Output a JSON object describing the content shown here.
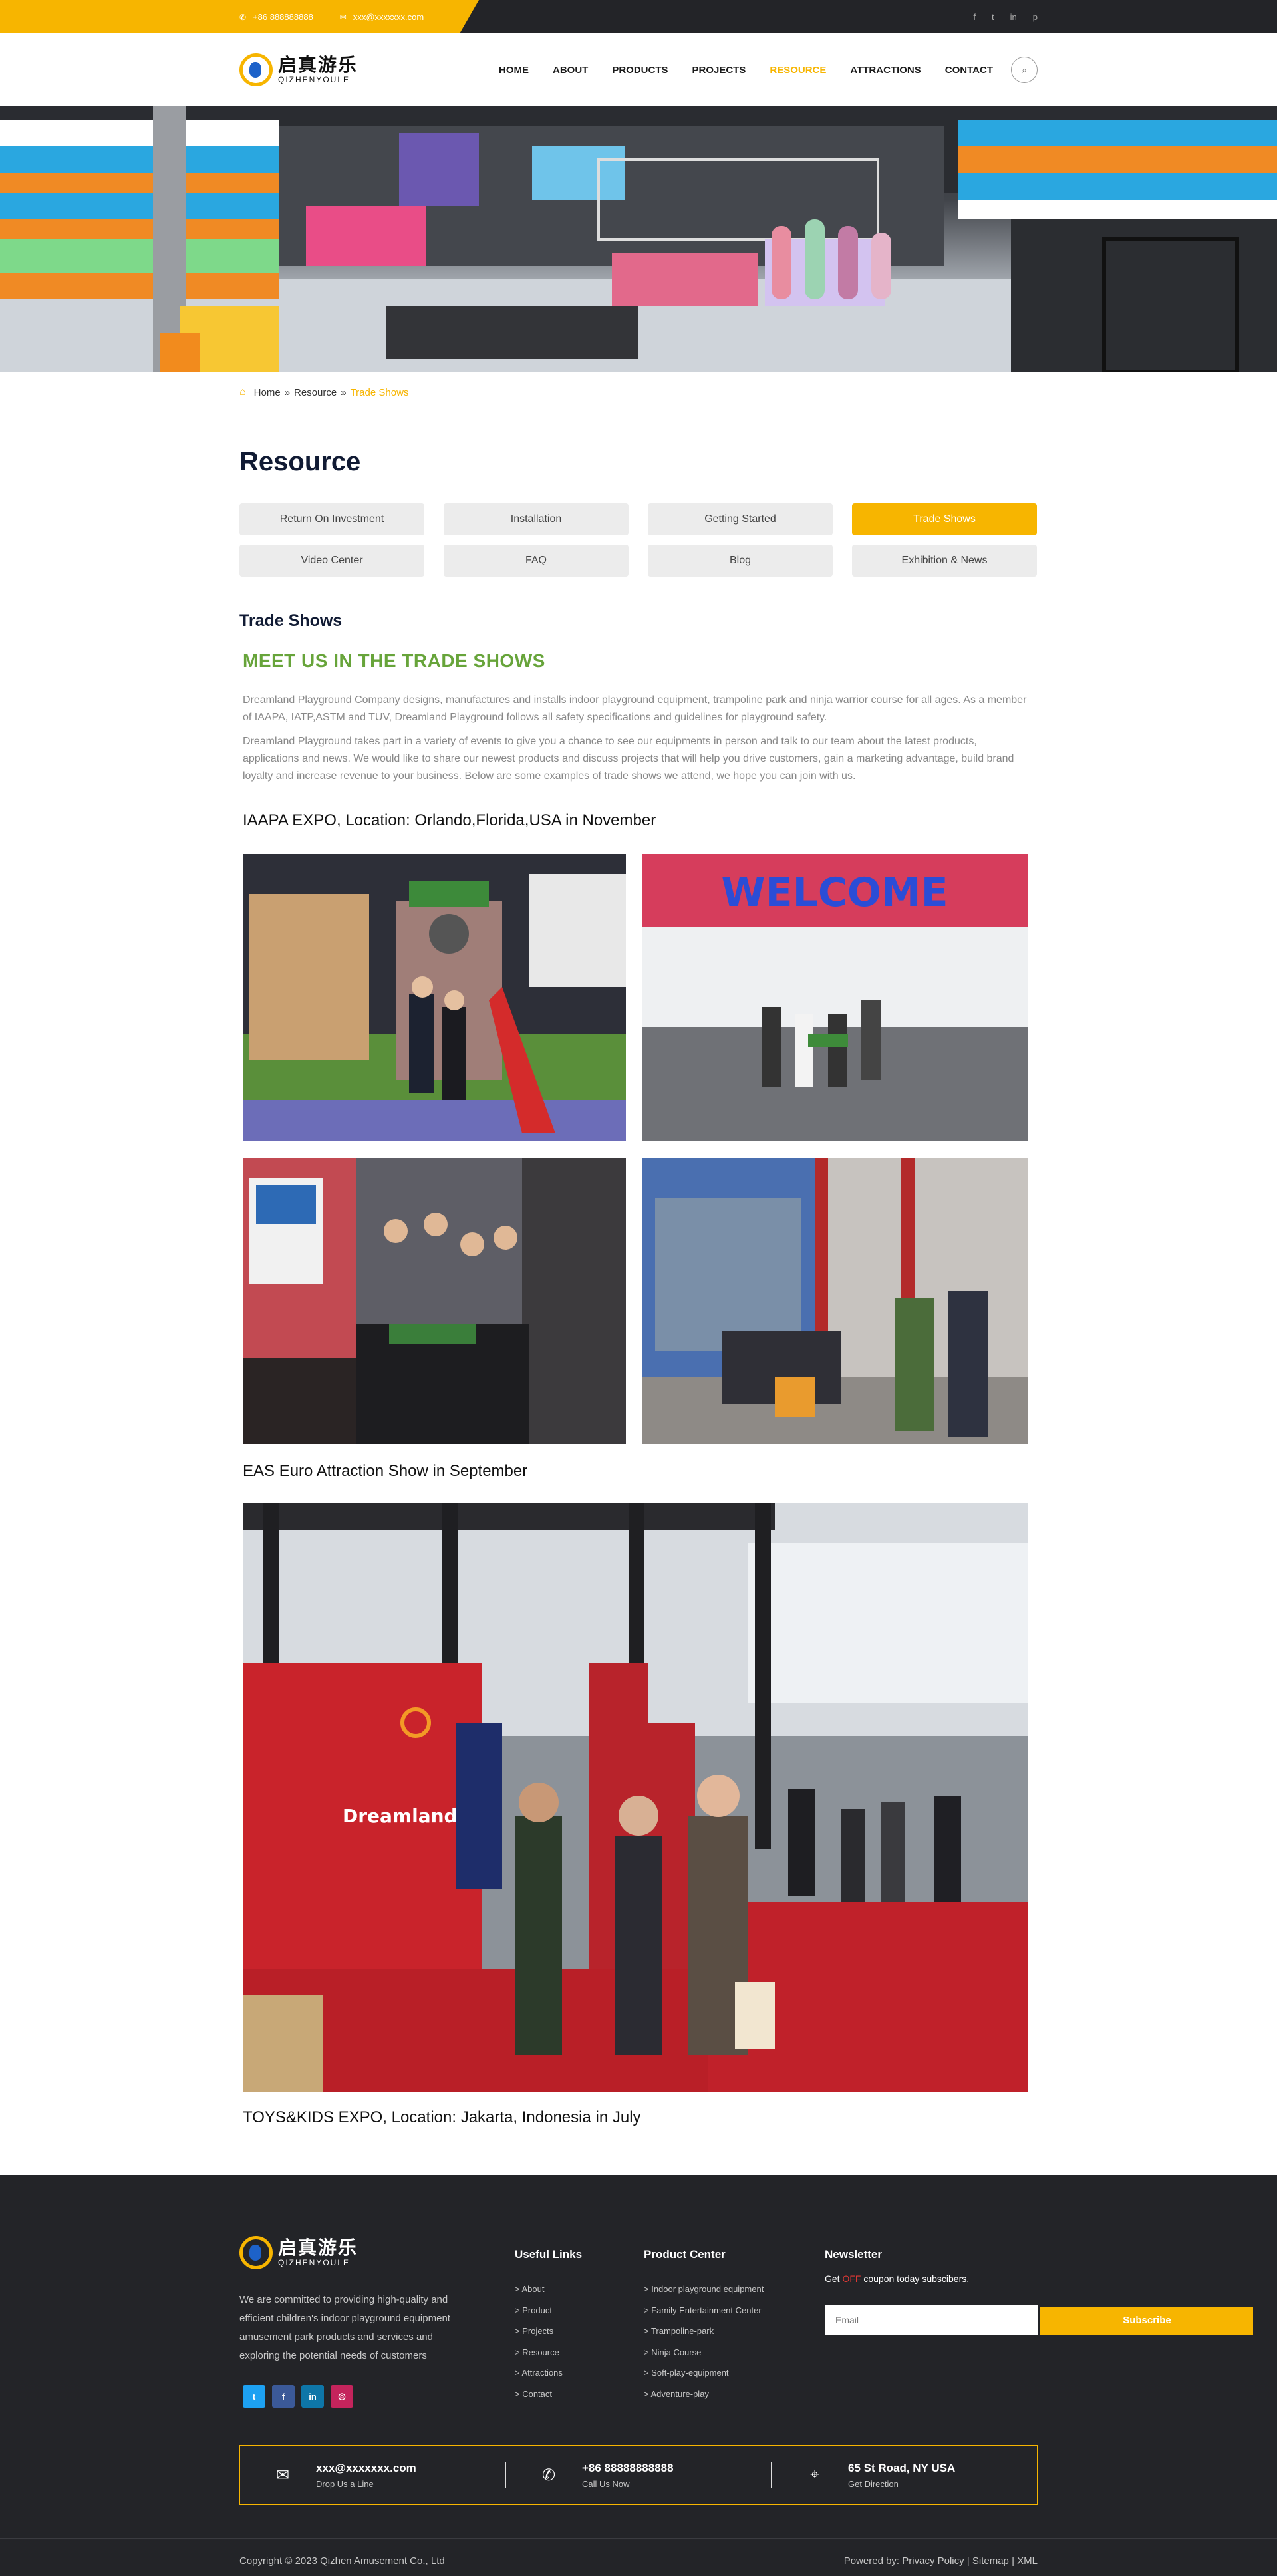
{
  "topbar": {
    "phone": "+86 888888888",
    "email": "xxx@xxxxxxx.com",
    "social_icons": [
      "facebook-icon",
      "twitter-icon",
      "linkedin-icon",
      "pinterest-icon"
    ]
  },
  "brand": {
    "name_cn": "启真游乐",
    "name_en": "QIZHENYOULE",
    "accent": "#f7b500",
    "dark": "#232428"
  },
  "nav": {
    "items": [
      {
        "label": "HOME",
        "active": false
      },
      {
        "label": "ABOUT",
        "active": false
      },
      {
        "label": "PRODUCTS",
        "active": false
      },
      {
        "label": "PROJECTS",
        "active": false
      },
      {
        "label": "RESOURCE",
        "active": true
      },
      {
        "label": "ATTRACTIONS",
        "active": false
      },
      {
        "label": "CONTACT",
        "active": false
      }
    ]
  },
  "breadcrumb": {
    "home": "Home",
    "sep1": "»",
    "parent": "Resource",
    "sep2": "»",
    "current": "Trade Shows"
  },
  "main": {
    "title": "Resource",
    "tabs": [
      {
        "label": "Return On Investment",
        "active": false
      },
      {
        "label": "Installation",
        "active": false
      },
      {
        "label": "Getting Started",
        "active": false
      },
      {
        "label": "Trade Shows",
        "active": true
      },
      {
        "label": "Video Center",
        "active": false
      },
      {
        "label": "FAQ",
        "active": false
      },
      {
        "label": "Blog",
        "active": false
      },
      {
        "label": "Exhibition & News",
        "active": false
      }
    ],
    "section_title": "Trade Shows",
    "heading": "MEET US IN THE TRADE SHOWS",
    "paragraph1": "Dreamland Playground Company designs, manufactures and installs indoor playground equipment, trampoline park and ninja warrior course for all ages. As a member of IAAPA, IATP,ASTM and TUV, Dreamland Playground follows all safety specifications and guidelines for playground safety.",
    "paragraph2": "Dreamland Playground takes part in a variety of events to give you a chance to see our equipments in person and talk to our team about the latest products, applications and news. We would like to share our newest products and discuss projects that will help you drive customers, gain a marketing advantage, build brand loyalty and increase revenue to your business. Below are some examples of trade shows we attend, we hope you can join with us.",
    "show1": "IAAPA EXPO, Location: Orlando,Florida,USA in November",
    "show2": "EAS Euro Attraction Show in September",
    "show3": "TOYS&KIDS EXPO, Location: Jakarta, Indonesia in July",
    "welcome_sign": "WELCOME",
    "photo_sign": "Dreamland"
  },
  "footer": {
    "description": "We are committed to providing high-quality and efficient children's indoor playground equipment amusement park products and services and exploring the potential needs of customers",
    "social": [
      {
        "icon": "twitter-icon",
        "glyph": "t",
        "color": "#1da1f2"
      },
      {
        "icon": "facebook-icon",
        "glyph": "f",
        "color": "#3b5998"
      },
      {
        "icon": "linkedin-icon",
        "glyph": "in",
        "color": "#0e76a8"
      },
      {
        "icon": "instagram-icon",
        "glyph": "◎",
        "color": "#c4245c"
      }
    ],
    "useful_links": {
      "title": "Useful Links",
      "items": [
        "> About",
        "> Product",
        "> Projects",
        "> Resource",
        "> Attractions",
        "> Contact"
      ]
    },
    "product_center": {
      "title": "Product Center",
      "items": [
        "> Indoor playground equipment",
        "> Family Entertainment Center",
        "> Trampoline-park",
        "> Ninja Course",
        "> Soft-play-equipment",
        "> Adventure-play"
      ]
    },
    "newsletter": {
      "title": "Newsletter",
      "text_before": "Get ",
      "off": "OFF",
      "text_after": " coupon today subscibers.",
      "placeholder": "Email",
      "button": "Subscribe"
    },
    "contact": [
      {
        "icon": "mail-icon",
        "main": "xxx@xxxxxxx.com",
        "sub": "Drop Us a Line"
      },
      {
        "icon": "phone-icon",
        "main": "+86 88888888888",
        "sub": "Call Us Now"
      },
      {
        "icon": "location-icon",
        "main": "65 St Road, NY USA",
        "sub": "Get Direction"
      }
    ],
    "copyright": "Copyright © 2023 Qizhen Amusement Co., Ltd",
    "powered_by": "Powered by:",
    "privacy": "Privacy Policy",
    "sitemap": "Sitemap",
    "xml": "XML",
    "sep": "|"
  }
}
